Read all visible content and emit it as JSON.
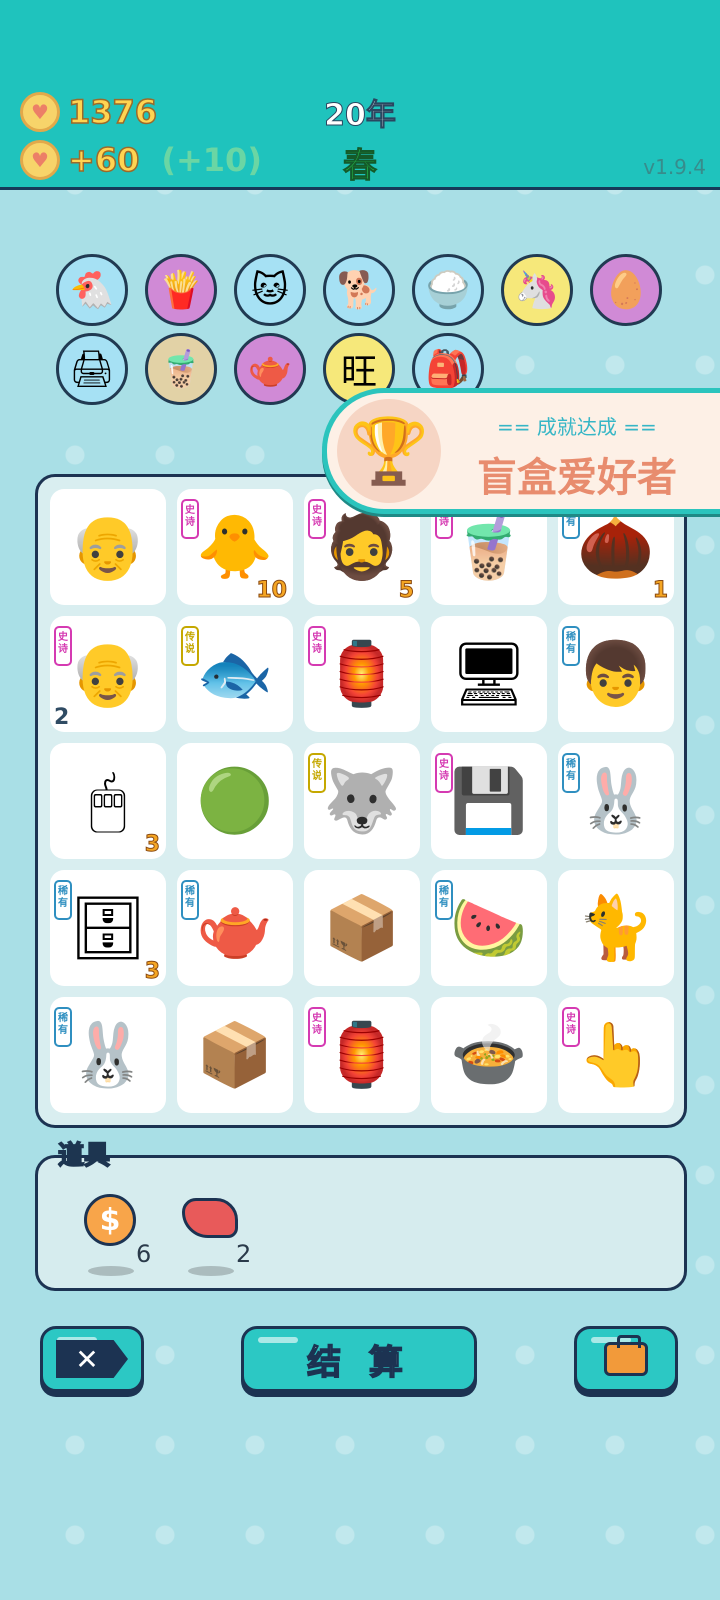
{
  "header": {
    "coins": "1376",
    "income": "+60",
    "bonus": "(+10)",
    "year": "20年",
    "season": "春",
    "version": "v1.9.4"
  },
  "symbols_row": [
    {
      "icon": "chicken-egg-icon",
      "glyph": "🐔",
      "bg": "#a6e1f4"
    },
    {
      "icon": "fries-icon",
      "glyph": "🍟",
      "bg": "#d08ad6"
    },
    {
      "icon": "cat-icon",
      "glyph": "🐱",
      "bg": "#a6e1f4"
    },
    {
      "icon": "dog-sunglasses-icon",
      "glyph": "🐕",
      "bg": "#a6e1f4"
    },
    {
      "icon": "rice-bowl-icon",
      "glyph": "🍚",
      "bg": "#a6e1f4"
    },
    {
      "icon": "unicorn-icon",
      "glyph": "🦄",
      "bg": "#f6e87a"
    },
    {
      "icon": "egg-icon",
      "glyph": "🥚",
      "bg": "#d08ad6"
    },
    {
      "icon": "printer-icon",
      "glyph": "🖨",
      "bg": "#a6e1f4"
    },
    {
      "icon": "milk-tea-icon",
      "glyph": "🧋",
      "bg": "#e2d2a6"
    },
    {
      "icon": "gravy-boat-icon",
      "glyph": "🫖",
      "bg": "#d08ad6"
    },
    {
      "icon": "wangwang-icon",
      "glyph": "旺",
      "bg": "#f6e87a"
    },
    {
      "icon": "sack-icon",
      "glyph": "🎒",
      "bg": "#a6e1f4"
    }
  ],
  "achievement": {
    "subtitle": "== 成就达成 ==",
    "title": "盲盒爱好者"
  },
  "board": [
    {
      "icon": "old-man-icon",
      "glyph": "👴",
      "tag": "",
      "tagclass": "",
      "count": ""
    },
    {
      "icon": "yellow-chick-icon",
      "glyph": "🐥",
      "tag": "史诗",
      "tagclass": "epic",
      "count": "10"
    },
    {
      "icon": "green-hat-man-icon",
      "glyph": "🧔",
      "tag": "史诗",
      "tagclass": "epic",
      "count": "5"
    },
    {
      "icon": "bubble-tea-icon",
      "glyph": "🧋",
      "tag": "史诗",
      "tagclass": "epic",
      "count": ""
    },
    {
      "icon": "nut-icon",
      "glyph": "🌰",
      "tag": "稀有",
      "tagclass": "rare",
      "count": "1"
    },
    {
      "icon": "grandpa-icon",
      "glyph": "👴",
      "tag": "史诗",
      "tagclass": "epic",
      "count": "2",
      "countpos": "left"
    },
    {
      "icon": "koi-fish-icon",
      "glyph": "🐟",
      "tag": "传说",
      "tagclass": "leg",
      "count": ""
    },
    {
      "icon": "rabbit-house-icon",
      "glyph": "🏮",
      "tag": "史诗",
      "tagclass": "epic",
      "count": ""
    },
    {
      "icon": "monitor-icon",
      "glyph": "🖥",
      "tag": "",
      "tagclass": "",
      "count": ""
    },
    {
      "icon": "boy-icon",
      "glyph": "👦",
      "tag": "稀有",
      "tagclass": "rare",
      "count": ""
    },
    {
      "icon": "mouse-icon",
      "glyph": "🖱",
      "tag": "",
      "tagclass": "",
      "count": "3"
    },
    {
      "icon": "slime-capsule-icon",
      "glyph": "🟢",
      "tag": "",
      "tagclass": "",
      "count": ""
    },
    {
      "icon": "husky-king-icon",
      "glyph": "🐺",
      "tag": "传说",
      "tagclass": "leg",
      "count": ""
    },
    {
      "icon": "graphics-card-icon",
      "glyph": "💾",
      "tag": "史诗",
      "tagclass": "epic",
      "count": ""
    },
    {
      "icon": "rabbit-icon",
      "glyph": "🐰",
      "tag": "稀有",
      "tagclass": "rare",
      "count": ""
    },
    {
      "icon": "pc-tower-icon",
      "glyph": "🗄",
      "tag": "稀有",
      "tagclass": "rare",
      "count": "3"
    },
    {
      "icon": "teapot-icon",
      "glyph": "🫖",
      "tag": "稀有",
      "tagclass": "rare",
      "count": ""
    },
    {
      "icon": "box-icon",
      "glyph": "📦",
      "tag": "",
      "tagclass": "",
      "count": ""
    },
    {
      "icon": "watermelon-icon",
      "glyph": "🍉",
      "tag": "稀有",
      "tagclass": "rare",
      "count": ""
    },
    {
      "icon": "cat-standing-icon",
      "glyph": "🐈",
      "tag": "",
      "tagclass": "",
      "count": ""
    },
    {
      "icon": "rabbit-icon",
      "glyph": "🐰",
      "tag": "稀有",
      "tagclass": "rare",
      "count": ""
    },
    {
      "icon": "box-icon",
      "glyph": "📦",
      "tag": "",
      "tagclass": "",
      "count": ""
    },
    {
      "icon": "rabbit-house-icon",
      "glyph": "🏮",
      "tag": "史诗",
      "tagclass": "epic",
      "count": ""
    },
    {
      "icon": "soup-bowl-icon",
      "glyph": "🍲",
      "tag": "",
      "tagclass": "",
      "count": ""
    },
    {
      "icon": "pointing-hand-icon",
      "glyph": "👆",
      "tag": "史诗",
      "tagclass": "epic",
      "count": ""
    }
  ],
  "props": {
    "title": "道具",
    "items": [
      {
        "icon": "coin-icon",
        "glyph": "$",
        "count": "6"
      },
      {
        "icon": "liver-icon",
        "glyph": "",
        "count": "2"
      }
    ]
  },
  "buttons": {
    "settle": "结 算",
    "delete_icon": "✕"
  }
}
